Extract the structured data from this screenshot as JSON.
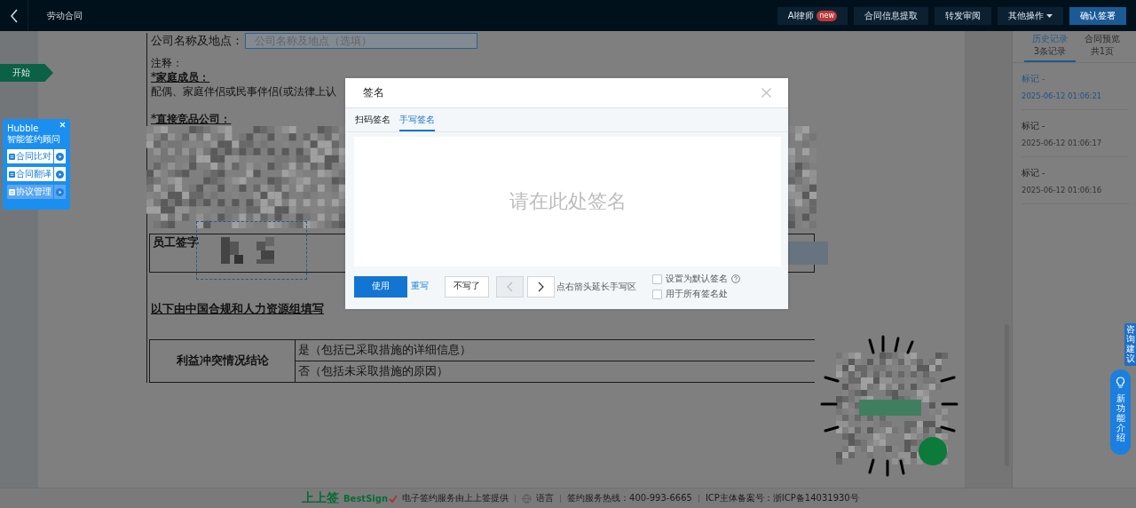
{
  "header": {
    "title": "劳动合同",
    "actions": [
      {
        "label": "AI律师",
        "kind": "badge",
        "badge": "new"
      },
      {
        "label": "合同信息提取",
        "kind": "plain"
      },
      {
        "label": "转发审阅",
        "kind": "plain"
      },
      {
        "label": "其他操作",
        "kind": "dropdown"
      },
      {
        "label": "确认签署",
        "kind": "primary"
      }
    ]
  },
  "start_tag": "开始",
  "hubble": {
    "title": "Hubble",
    "subtitle": "智能签约顾问",
    "items": [
      {
        "label": "合同比对",
        "selected": false
      },
      {
        "label": "合同翻译",
        "selected": false
      },
      {
        "label": "协议管理",
        "selected": true
      }
    ]
  },
  "document": {
    "company_label": "公司名称及地点：",
    "company_field": {
      "placeholder": "公司名称及地点（选填）"
    },
    "notes": [
      {
        "text": "注释：",
        "kind": "plain"
      },
      {
        "text": "*家庭成员：",
        "kind": "heading"
      },
      {
        "text": "配偶、家庭伴侣或民事伴侣(或法律上认",
        "kind": "plain"
      },
      {
        "text": "*直接竞品公司：",
        "kind": "heading"
      }
    ],
    "signature_row": {
      "label": "员工签字"
    },
    "section_title": "以下由中国合规和人力资源组填写",
    "conflict_table": {
      "label": "利益冲突情况结论",
      "options": [
        "是（包括已采取措施的详细信息）",
        "否（包括未采取措施的原因）"
      ]
    }
  },
  "sidebar": {
    "tabs": [
      {
        "label": "历史记录",
        "sub": "3条记录",
        "selected": true
      },
      {
        "label": "合同预览",
        "sub": "共1页",
        "selected": false
      }
    ],
    "records": [
      {
        "title": "标记 -",
        "time": "2025-06-12 01:06:21",
        "selected": true
      },
      {
        "title": "标记 -",
        "time": "2025-06-12 01:06:17",
        "selected": false
      },
      {
        "title": "标记 -",
        "time": "2025-06-12 01:06:16",
        "selected": false
      }
    ]
  },
  "floating": {
    "feedback": "咨询建议",
    "new_features": "新功能介绍"
  },
  "footer": {
    "brand": "上上签",
    "brand_en": "BestSign",
    "provider": "电子签约服务由上上签提供",
    "language": "语言",
    "hotline": "签约服务热线：400-993-6665",
    "icp": "ICP主体备案号：浙ICP备14031930号"
  },
  "dialog": {
    "title": "签名",
    "tabs": [
      {
        "label": "扫码签名",
        "selected": false
      },
      {
        "label": "手写签名",
        "selected": true
      }
    ],
    "canvas_placeholder": "请在此处签名",
    "buttons": [
      {
        "label": "使用",
        "kind": "primary"
      },
      {
        "label": "重写",
        "kind": "link"
      },
      {
        "label": "不写了",
        "kind": "plain"
      }
    ],
    "prev_disabled": true,
    "next_disabled": false,
    "hint": "点右箭头延长手写区",
    "options": [
      {
        "label": "设置为默认签名",
        "checked": false,
        "help": true
      },
      {
        "label": "用于所有签名处",
        "checked": false,
        "help": false
      }
    ]
  }
}
